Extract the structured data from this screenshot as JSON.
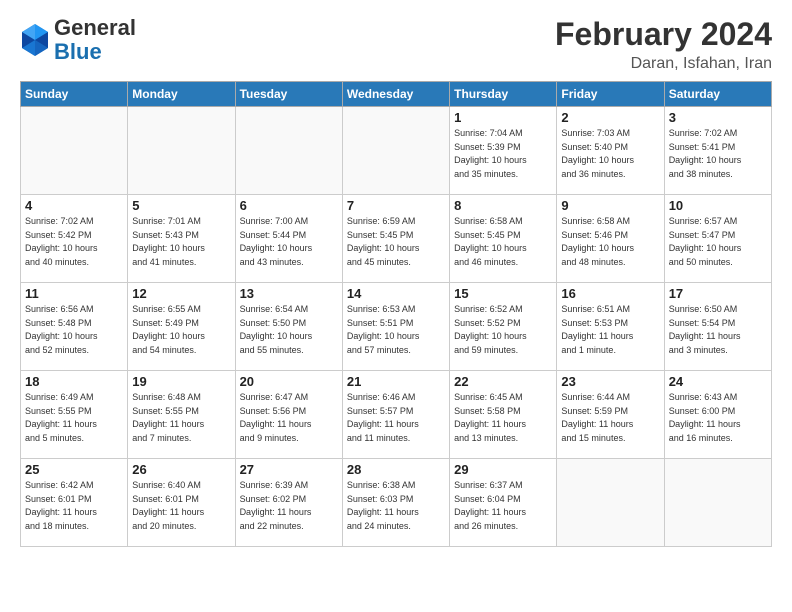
{
  "header": {
    "logo_general": "General",
    "logo_blue": "Blue",
    "month_title": "February 2024",
    "location": "Daran, Isfahan, Iran"
  },
  "weekdays": [
    "Sunday",
    "Monday",
    "Tuesday",
    "Wednesday",
    "Thursday",
    "Friday",
    "Saturday"
  ],
  "weeks": [
    [
      {
        "day": "",
        "info": ""
      },
      {
        "day": "",
        "info": ""
      },
      {
        "day": "",
        "info": ""
      },
      {
        "day": "",
        "info": ""
      },
      {
        "day": "1",
        "info": "Sunrise: 7:04 AM\nSunset: 5:39 PM\nDaylight: 10 hours\nand 35 minutes."
      },
      {
        "day": "2",
        "info": "Sunrise: 7:03 AM\nSunset: 5:40 PM\nDaylight: 10 hours\nand 36 minutes."
      },
      {
        "day": "3",
        "info": "Sunrise: 7:02 AM\nSunset: 5:41 PM\nDaylight: 10 hours\nand 38 minutes."
      }
    ],
    [
      {
        "day": "4",
        "info": "Sunrise: 7:02 AM\nSunset: 5:42 PM\nDaylight: 10 hours\nand 40 minutes."
      },
      {
        "day": "5",
        "info": "Sunrise: 7:01 AM\nSunset: 5:43 PM\nDaylight: 10 hours\nand 41 minutes."
      },
      {
        "day": "6",
        "info": "Sunrise: 7:00 AM\nSunset: 5:44 PM\nDaylight: 10 hours\nand 43 minutes."
      },
      {
        "day": "7",
        "info": "Sunrise: 6:59 AM\nSunset: 5:45 PM\nDaylight: 10 hours\nand 45 minutes."
      },
      {
        "day": "8",
        "info": "Sunrise: 6:58 AM\nSunset: 5:45 PM\nDaylight: 10 hours\nand 46 minutes."
      },
      {
        "day": "9",
        "info": "Sunrise: 6:58 AM\nSunset: 5:46 PM\nDaylight: 10 hours\nand 48 minutes."
      },
      {
        "day": "10",
        "info": "Sunrise: 6:57 AM\nSunset: 5:47 PM\nDaylight: 10 hours\nand 50 minutes."
      }
    ],
    [
      {
        "day": "11",
        "info": "Sunrise: 6:56 AM\nSunset: 5:48 PM\nDaylight: 10 hours\nand 52 minutes."
      },
      {
        "day": "12",
        "info": "Sunrise: 6:55 AM\nSunset: 5:49 PM\nDaylight: 10 hours\nand 54 minutes."
      },
      {
        "day": "13",
        "info": "Sunrise: 6:54 AM\nSunset: 5:50 PM\nDaylight: 10 hours\nand 55 minutes."
      },
      {
        "day": "14",
        "info": "Sunrise: 6:53 AM\nSunset: 5:51 PM\nDaylight: 10 hours\nand 57 minutes."
      },
      {
        "day": "15",
        "info": "Sunrise: 6:52 AM\nSunset: 5:52 PM\nDaylight: 10 hours\nand 59 minutes."
      },
      {
        "day": "16",
        "info": "Sunrise: 6:51 AM\nSunset: 5:53 PM\nDaylight: 11 hours\nand 1 minute."
      },
      {
        "day": "17",
        "info": "Sunrise: 6:50 AM\nSunset: 5:54 PM\nDaylight: 11 hours\nand 3 minutes."
      }
    ],
    [
      {
        "day": "18",
        "info": "Sunrise: 6:49 AM\nSunset: 5:55 PM\nDaylight: 11 hours\nand 5 minutes."
      },
      {
        "day": "19",
        "info": "Sunrise: 6:48 AM\nSunset: 5:55 PM\nDaylight: 11 hours\nand 7 minutes."
      },
      {
        "day": "20",
        "info": "Sunrise: 6:47 AM\nSunset: 5:56 PM\nDaylight: 11 hours\nand 9 minutes."
      },
      {
        "day": "21",
        "info": "Sunrise: 6:46 AM\nSunset: 5:57 PM\nDaylight: 11 hours\nand 11 minutes."
      },
      {
        "day": "22",
        "info": "Sunrise: 6:45 AM\nSunset: 5:58 PM\nDaylight: 11 hours\nand 13 minutes."
      },
      {
        "day": "23",
        "info": "Sunrise: 6:44 AM\nSunset: 5:59 PM\nDaylight: 11 hours\nand 15 minutes."
      },
      {
        "day": "24",
        "info": "Sunrise: 6:43 AM\nSunset: 6:00 PM\nDaylight: 11 hours\nand 16 minutes."
      }
    ],
    [
      {
        "day": "25",
        "info": "Sunrise: 6:42 AM\nSunset: 6:01 PM\nDaylight: 11 hours\nand 18 minutes."
      },
      {
        "day": "26",
        "info": "Sunrise: 6:40 AM\nSunset: 6:01 PM\nDaylight: 11 hours\nand 20 minutes."
      },
      {
        "day": "27",
        "info": "Sunrise: 6:39 AM\nSunset: 6:02 PM\nDaylight: 11 hours\nand 22 minutes."
      },
      {
        "day": "28",
        "info": "Sunrise: 6:38 AM\nSunset: 6:03 PM\nDaylight: 11 hours\nand 24 minutes."
      },
      {
        "day": "29",
        "info": "Sunrise: 6:37 AM\nSunset: 6:04 PM\nDaylight: 11 hours\nand 26 minutes."
      },
      {
        "day": "",
        "info": ""
      },
      {
        "day": "",
        "info": ""
      }
    ]
  ]
}
